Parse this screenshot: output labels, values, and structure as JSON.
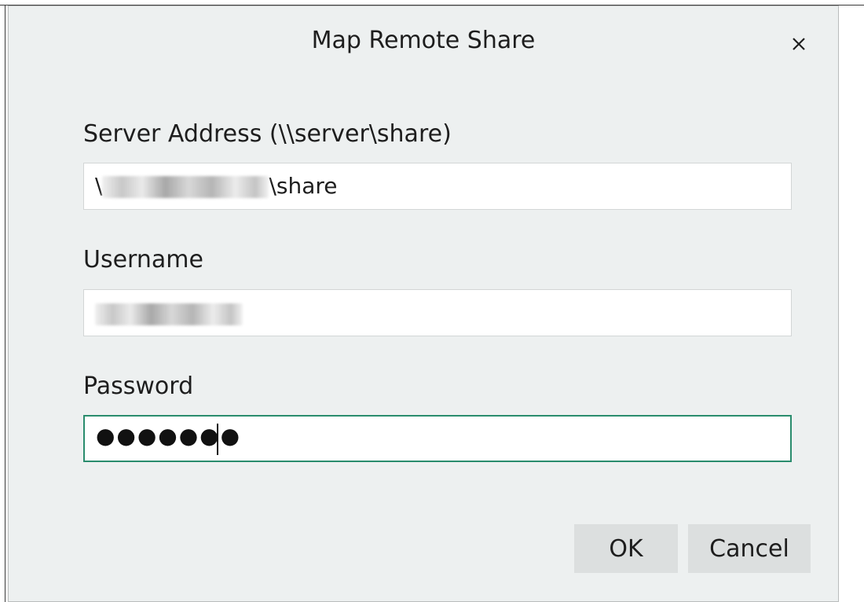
{
  "dialog": {
    "title": "Map Remote Share",
    "close_icon": "close-icon"
  },
  "server": {
    "label": "Server Address (\\\\server\\share)",
    "value_prefix": "\\",
    "value_suffix": "\\share"
  },
  "username": {
    "label": "Username"
  },
  "password": {
    "label": "Password",
    "masked_value": "●●●●●●●",
    "focused": true
  },
  "buttons": {
    "ok_label": "OK",
    "cancel_label": "Cancel"
  },
  "colors": {
    "dialog_bg": "#edf0f0",
    "focus_accent": "#2a8c6d",
    "button_bg": "#dcdfdf"
  }
}
